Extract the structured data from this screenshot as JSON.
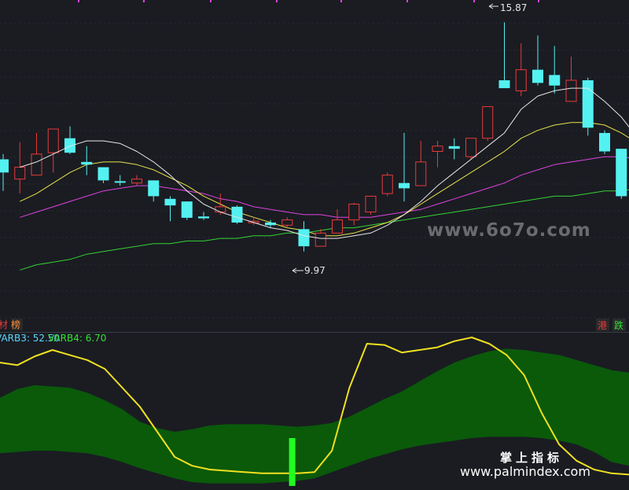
{
  "chart_data": [
    {
      "type": "candlestick",
      "annotations": {
        "high": "15.87",
        "low": "9.97"
      },
      "tags_left": [
        "材",
        "榜"
      ],
      "tags_right": [
        "港",
        "跌"
      ],
      "candles": [
        {
          "o": 14.2,
          "c": 13.7,
          "h": 14.4,
          "l": 13.0
        },
        {
          "o": 13.45,
          "c": 13.9,
          "h": 14.85,
          "l": 12.9
        },
        {
          "o": 13.6,
          "c": 14.4,
          "h": 15.2,
          "l": 13.6
        },
        {
          "o": 14.45,
          "c": 15.35,
          "h": 15.35,
          "l": 13.7
        },
        {
          "o": 15.0,
          "c": 14.45,
          "h": 15.45,
          "l": 14.4
        },
        {
          "o": 14.1,
          "c": 14.0,
          "h": 14.7,
          "l": 13.6
        },
        {
          "o": 13.9,
          "c": 13.4,
          "h": 13.9,
          "l": 13.3
        },
        {
          "o": 13.37,
          "c": 13.32,
          "h": 13.6,
          "l": 13.2
        },
        {
          "o": 13.3,
          "c": 13.45,
          "h": 13.6,
          "l": 13.2
        },
        {
          "o": 13.4,
          "c": 12.8,
          "h": 13.4,
          "l": 12.6
        },
        {
          "o": 12.7,
          "c": 12.45,
          "h": 12.8,
          "l": 11.85
        },
        {
          "o": 12.6,
          "c": 11.98,
          "h": 12.6,
          "l": 11.9
        },
        {
          "o": 12.03,
          "c": 11.96,
          "h": 12.2,
          "l": 11.9
        },
        {
          "o": 12.2,
          "c": 12.4,
          "h": 12.9,
          "l": 12.1
        },
        {
          "o": 12.4,
          "c": 11.8,
          "h": 12.45,
          "l": 11.75
        },
        {
          "o": 11.8,
          "c": 11.85,
          "h": 12.0,
          "l": 11.7
        },
        {
          "o": 11.8,
          "c": 11.7,
          "h": 11.9,
          "l": 11.6
        },
        {
          "o": 11.7,
          "c": 11.9,
          "h": 12.0,
          "l": 11.6
        },
        {
          "o": 11.55,
          "c": 10.9,
          "h": 11.85,
          "l": 10.7
        },
        {
          "o": 10.9,
          "c": 11.4,
          "h": 11.55,
          "l": 10.9
        },
        {
          "o": 11.4,
          "c": 11.9,
          "h": 12.3,
          "l": 11.4
        },
        {
          "o": 11.9,
          "c": 12.5,
          "h": 12.55,
          "l": 11.7
        },
        {
          "o": 12.2,
          "c": 12.8,
          "h": 12.8,
          "l": 12.1
        },
        {
          "o": 12.9,
          "c": 13.6,
          "h": 13.7,
          "l": 12.8
        },
        {
          "o": 13.3,
          "c": 13.1,
          "h": 15.2,
          "l": 12.6
        },
        {
          "o": 13.2,
          "c": 14.1,
          "h": 14.9,
          "l": 13.2
        },
        {
          "o": 14.5,
          "c": 14.7,
          "h": 14.9,
          "l": 13.9
        },
        {
          "o": 14.7,
          "c": 14.6,
          "h": 15.0,
          "l": 14.2
        },
        {
          "o": 14.3,
          "c": 15.0,
          "h": 15.0,
          "l": 14.2
        },
        {
          "o": 15.0,
          "c": 16.2,
          "h": 16.2,
          "l": 14.9
        },
        {
          "o": 17.2,
          "c": 16.9,
          "h": 19.4,
          "l": 16.9
        },
        {
          "o": 16.8,
          "c": 17.6,
          "h": 18.6,
          "l": 16.6
        },
        {
          "o": 17.6,
          "c": 17.1,
          "h": 18.9,
          "l": 17.0
        },
        {
          "o": 17.4,
          "c": 17.0,
          "h": 18.5,
          "l": 16.7
        },
        {
          "o": 16.4,
          "c": 17.2,
          "h": 18.1,
          "l": 16.4
        },
        {
          "o": 17.2,
          "c": 15.4,
          "h": 17.3,
          "l": 15.1
        },
        {
          "o": 15.2,
          "c": 14.5,
          "h": 15.3,
          "l": 14.4
        },
        {
          "o": 14.6,
          "c": 12.8,
          "h": 14.6,
          "l": 12.7
        },
        {
          "o": 12.5,
          "c": 10.8,
          "h": 12.5,
          "l": 10.8
        }
      ],
      "ma_white": [
        13.9,
        14.1,
        14.4,
        14.7,
        14.9,
        14.9,
        14.8,
        14.5,
        14.1,
        13.6,
        13.0,
        12.5,
        12.2,
        12.0,
        11.8,
        11.6,
        11.5,
        11.3,
        11.2,
        11.2,
        11.3,
        11.4,
        11.7,
        12.1,
        12.6,
        13.2,
        13.7,
        14.2,
        14.7,
        15.2,
        16.1,
        16.6,
        16.8,
        16.9,
        16.9,
        16.4,
        15.8,
        15.0,
        14.0
      ],
      "ma_yellow": [
        12.6,
        12.9,
        13.3,
        13.7,
        14.0,
        14.1,
        14.1,
        14.0,
        13.8,
        13.5,
        13.2,
        12.8,
        12.5,
        12.2,
        12.0,
        11.8,
        11.6,
        11.5,
        11.3,
        11.3,
        11.4,
        11.6,
        11.8,
        12.1,
        12.5,
        12.9,
        13.3,
        13.7,
        14.1,
        14.5,
        15.0,
        15.3,
        15.5,
        15.6,
        15.6,
        15.5,
        15.2,
        14.8,
        14.2
      ],
      "ma_magenta": [
        12.0,
        12.2,
        12.4,
        12.6,
        12.8,
        13.0,
        13.1,
        13.2,
        13.2,
        13.1,
        13.0,
        12.9,
        12.7,
        12.6,
        12.4,
        12.3,
        12.2,
        12.1,
        12.1,
        12.0,
        12.0,
        12.0,
        12.1,
        12.2,
        12.3,
        12.5,
        12.7,
        12.9,
        13.1,
        13.3,
        13.6,
        13.8,
        14.0,
        14.1,
        14.2,
        14.3,
        14.3,
        14.2,
        14.1
      ],
      "ma_green": [
        10.0,
        10.2,
        10.3,
        10.4,
        10.6,
        10.7,
        10.8,
        10.9,
        11.0,
        11.0,
        11.1,
        11.1,
        11.2,
        11.2,
        11.3,
        11.3,
        11.4,
        11.4,
        11.5,
        11.6,
        11.6,
        11.7,
        11.8,
        11.9,
        12.0,
        12.1,
        12.2,
        12.3,
        12.4,
        12.5,
        12.6,
        12.7,
        12.8,
        12.8,
        12.9,
        13.0,
        13.0,
        13.1,
        13.1
      ],
      "colors": {
        "up": "#e63a3a",
        "down": "#54f1f1",
        "white": "#e6e6e6",
        "yellow": "#e8e14a",
        "magenta": "#e042e0",
        "green": "#35d235"
      }
    },
    {
      "type": "area",
      "legend": [
        {
          "label": "VARB3: 52.50",
          "color": "#5ad8ff"
        },
        {
          "label": "VARB4: 6.70",
          "color": "#33e033"
        }
      ],
      "band_upper": [
        62,
        69,
        72,
        71,
        70,
        66,
        60,
        53,
        43,
        38,
        35,
        37,
        40,
        41,
        41,
        41,
        40,
        39,
        40,
        42,
        47,
        54,
        61,
        67,
        75,
        83,
        90,
        95,
        99,
        101,
        100,
        98,
        96,
        92,
        88,
        84,
        82
      ],
      "band_lower": [
        18,
        19,
        20,
        20,
        19,
        18,
        15,
        11,
        6,
        2,
        -2,
        -5,
        -6,
        -6,
        -6,
        -6,
        -5,
        -4,
        -2,
        3,
        8,
        13,
        17,
        21,
        24,
        26,
        28,
        30,
        31,
        31,
        31,
        30,
        28,
        25,
        19,
        11,
        8
      ],
      "yellow_line": [
        90,
        88,
        95,
        100,
        96,
        92,
        85,
        70,
        55,
        35,
        15,
        8,
        5,
        4,
        3,
        2,
        2,
        2,
        3,
        20,
        70,
        105,
        104,
        98,
        100,
        102,
        107,
        110,
        105,
        96,
        80,
        50,
        25,
        12,
        5,
        2,
        1
      ],
      "bar_value": 30,
      "colors": {
        "band": "#0a5a0a",
        "yellow": "#f0e020",
        "bar": "#22ff22"
      }
    }
  ],
  "watermark": "www.6o7o.com",
  "footer": {
    "title": "掌上指标",
    "url": "www.palmindex.com"
  }
}
